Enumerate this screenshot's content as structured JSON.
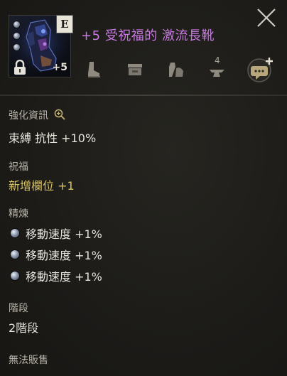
{
  "item": {
    "title": "+5 受祝福的 激流長靴",
    "grade": "E",
    "enhance": "+5",
    "icon": "boots-item-icon",
    "sockets": 3
  },
  "header_icons": [
    "boots-icon",
    "storage-box-icon",
    "weight-bag-icon",
    "enhance-anvil-icon"
  ],
  "anvil_count": "4",
  "enhance_info": {
    "label": "強化資訊",
    "value": "束縛 抗性 +10%"
  },
  "blessing": {
    "label": "祝福",
    "value": "新增欄位 +1"
  },
  "refine": {
    "label": "精煉",
    "items": [
      "移動速度 +1%",
      "移動速度 +1%",
      "移動速度 +1%"
    ]
  },
  "tier": {
    "label": "階段",
    "value": "2階段"
  },
  "sell_status": "無法販售",
  "colors": {
    "title": "#c77ae0",
    "accent_gold": "#d9c365",
    "background": "#1c1b18"
  }
}
